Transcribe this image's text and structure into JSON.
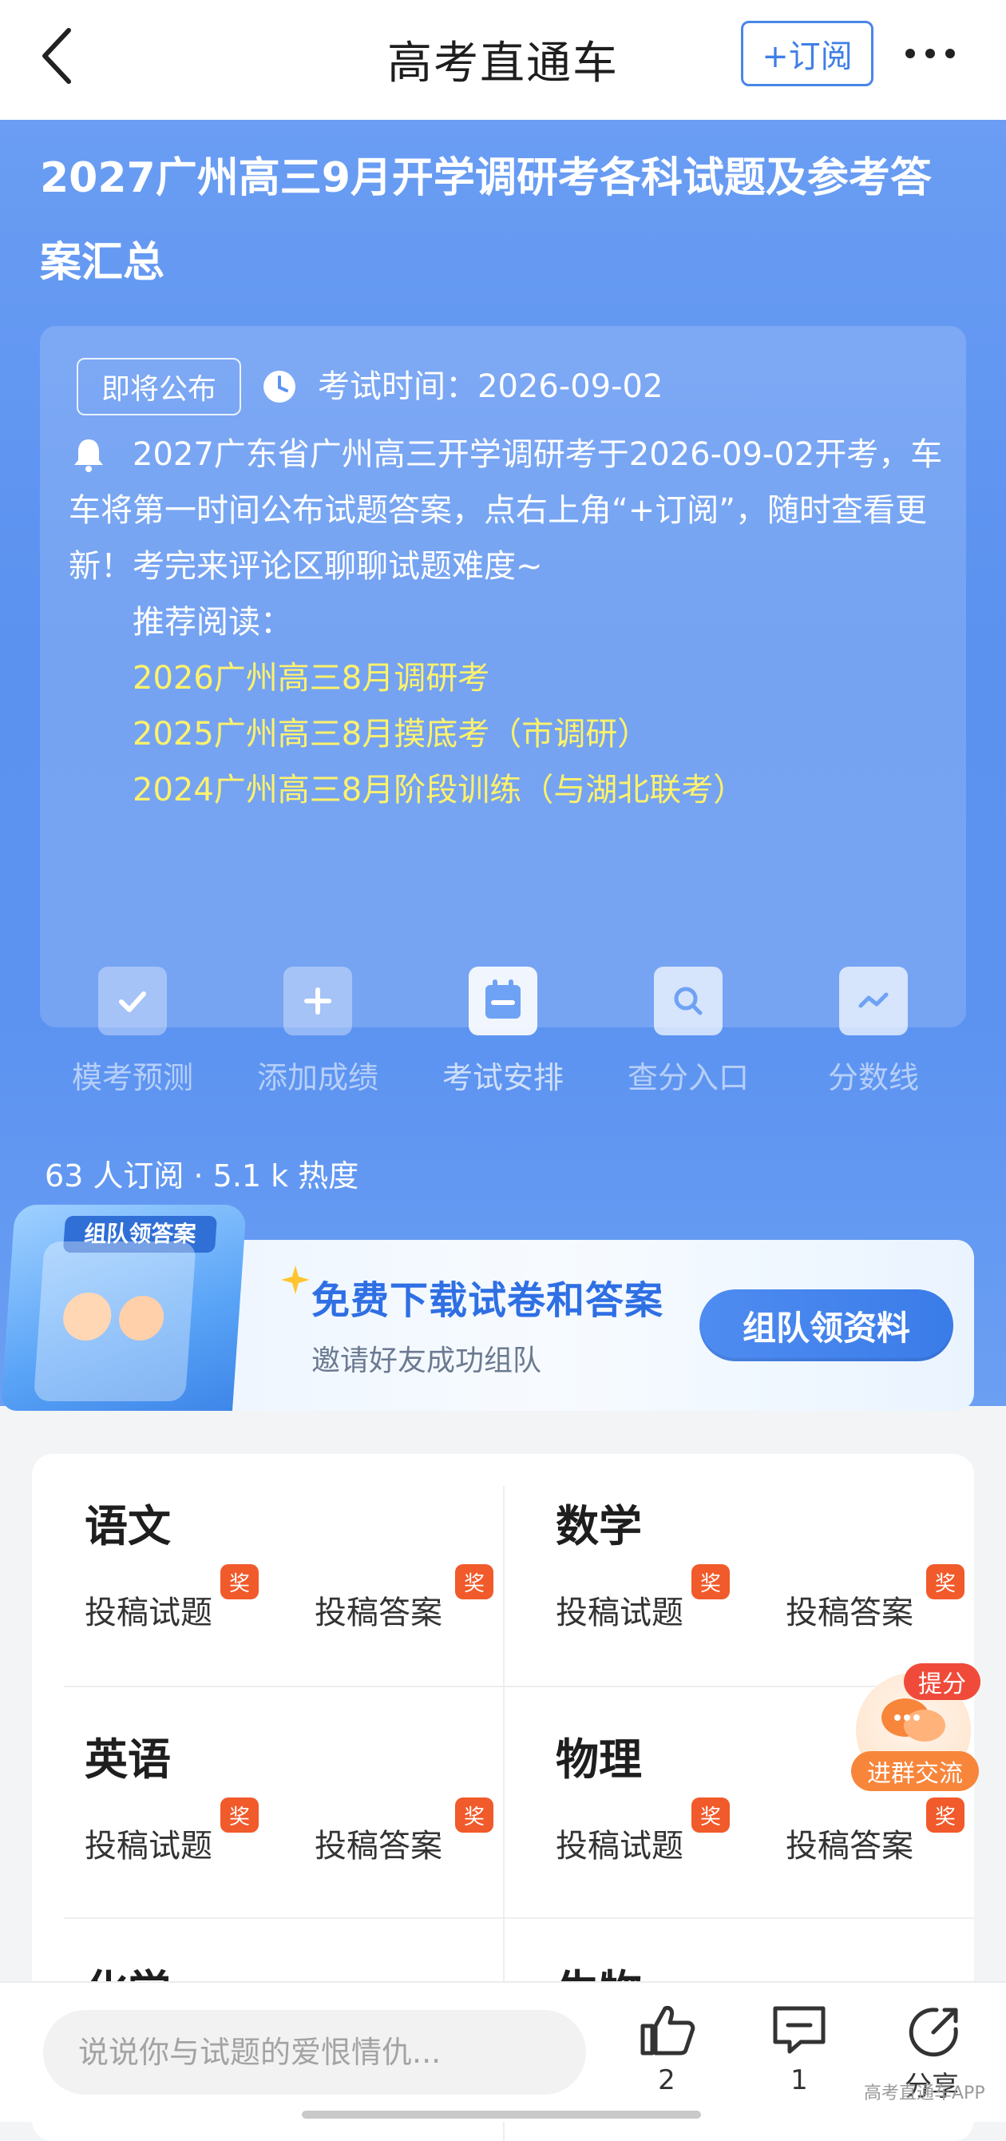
{
  "nav": {
    "title": "高考直通车",
    "subscribe_label": "+订阅"
  },
  "hero": {
    "title": "2027广州高三9月开学调研考各科试题及参考答案汇总",
    "status_tag": "即将公布",
    "exam_time": "考试时间：2026-09-02",
    "notice": "2027广东省广州高三开学调研考于2026-09-02开考，车车将第一时间公布试题答案，点右上角“+订阅”，随时查看更新！考完来评论区聊聊试题难度~",
    "recommend_label": "推荐阅读：",
    "recommend_links": [
      "2026广州高三8月调研考",
      "2025广州高三8月摸底考（市调研）",
      "2024广州高三8月阶段训练（与湖北联考）"
    ],
    "tools": [
      {
        "label": "模考预测",
        "icon": "check-calendar-icon"
      },
      {
        "label": "添加成绩",
        "icon": "plus-icon"
      },
      {
        "label": "考试安排",
        "icon": "calendar-icon"
      },
      {
        "label": "查分入口",
        "icon": "search-icon"
      },
      {
        "label": "分数线",
        "icon": "trend-line-icon"
      }
    ],
    "stats": "63 人订阅 · 5.1 k 热度"
  },
  "banner": {
    "art_badge": "组队领答案",
    "title": "免费下载试卷和答案",
    "subtitle": "邀请好友成功组队",
    "button": "组队领资料"
  },
  "subjects": [
    {
      "name": "语文",
      "actions": [
        "投稿试题",
        "投稿答案"
      ]
    },
    {
      "name": "数学",
      "actions": [
        "投稿试题",
        "投稿答案"
      ]
    },
    {
      "name": "英语",
      "actions": [
        "投稿试题",
        "投稿答案"
      ]
    },
    {
      "name": "物理",
      "actions": [
        "投稿试题",
        "投稿答案"
      ]
    },
    {
      "name": "化学",
      "actions": []
    },
    {
      "name": "生物",
      "actions": []
    }
  ],
  "award_badge": "奖",
  "float_chat": {
    "badge": "提分",
    "label": "进群交流"
  },
  "bottom": {
    "comment_placeholder": "说说你与试题的爱恨情仇...",
    "like_count": "2",
    "comment_count": "1",
    "share_label": "分享",
    "watermark": "高考直通车APP"
  },
  "colors": {
    "accent_blue": "#3f7fe6",
    "hero_blue": "#5c93f1",
    "link_yellow": "#fff26b",
    "award_red": "#f15a2a"
  }
}
